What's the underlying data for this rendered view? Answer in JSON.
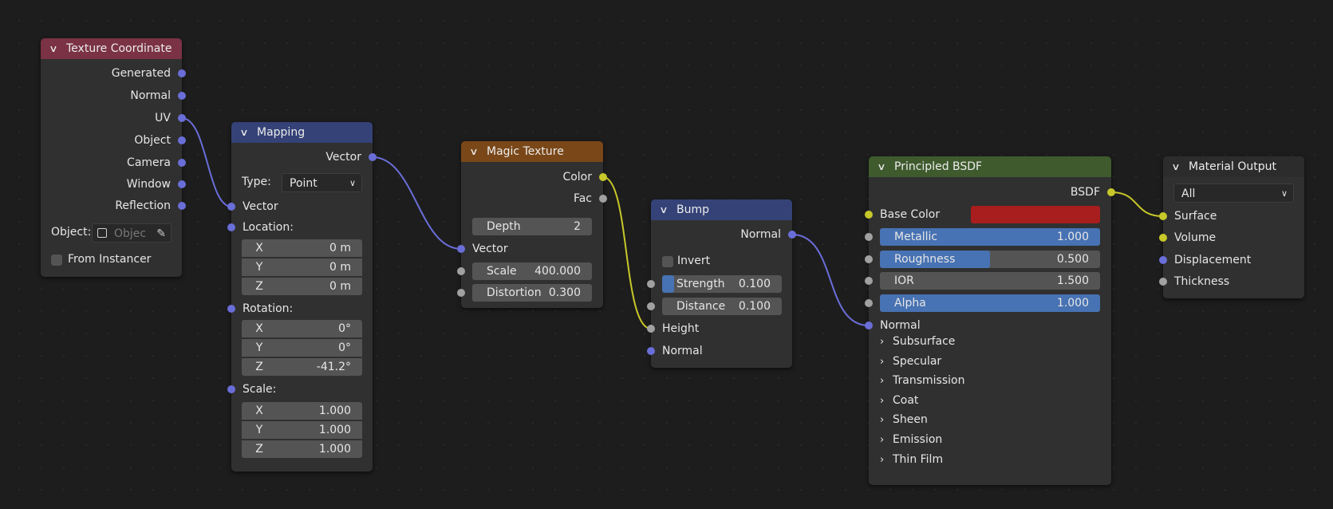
{
  "nodes": {
    "texture_coordinate": {
      "title": "Texture Coordinate",
      "header_color": "#7b3245",
      "outputs": [
        "Generated",
        "Normal",
        "UV",
        "Object",
        "Camera",
        "Window",
        "Reflection"
      ],
      "object_label": "Object:",
      "object_placeholder": "Objec",
      "from_instancer_label": "From Instancer",
      "from_instancer_checked": false
    },
    "mapping": {
      "title": "Mapping",
      "header_color": "#344277",
      "output": "Vector",
      "type_label": "Type:",
      "type_value": "Point",
      "vector_input": "Vector",
      "location_label": "Location:",
      "location": [
        {
          "axis": "X",
          "value": "0 m"
        },
        {
          "axis": "Y",
          "value": "0 m"
        },
        {
          "axis": "Z",
          "value": "0 m"
        }
      ],
      "rotation_label": "Rotation:",
      "rotation": [
        {
          "axis": "X",
          "value": "0°"
        },
        {
          "axis": "Y",
          "value": "0°"
        },
        {
          "axis": "Z",
          "value": "-41.2°"
        }
      ],
      "scale_label": "Scale:",
      "scale": [
        {
          "axis": "X",
          "value": "1.000"
        },
        {
          "axis": "Y",
          "value": "1.000"
        },
        {
          "axis": "Z",
          "value": "1.000"
        }
      ]
    },
    "magic_texture": {
      "title": "Magic Texture",
      "header_color": "#7a4718",
      "outputs": [
        "Color",
        "Fac"
      ],
      "depth_label": "Depth",
      "depth_value": "2",
      "vector_input": "Vector",
      "scale_label": "Scale",
      "scale_value": "400.000",
      "distortion_label": "Distortion",
      "distortion_value": "0.300"
    },
    "bump": {
      "title": "Bump",
      "header_color": "#344277",
      "output": "Normal",
      "invert_label": "Invert",
      "invert_checked": false,
      "strength_label": "Strength",
      "strength_value": "0.100",
      "strength_fraction": 0.1,
      "distance_label": "Distance",
      "distance_value": "0.100",
      "height_input": "Height",
      "normal_input": "Normal"
    },
    "principled_bsdf": {
      "title": "Principled BSDF",
      "header_color": "#3f5b2e",
      "output": "BSDF",
      "base_color_label": "Base Color",
      "base_color": "#a81d1d",
      "sliders": [
        {
          "label": "Metallic",
          "value": "1.000",
          "fraction": 1.0
        },
        {
          "label": "Roughness",
          "value": "0.500",
          "fraction": 0.5
        },
        {
          "label": "IOR",
          "value": "1.500",
          "fraction": 0.0
        },
        {
          "label": "Alpha",
          "value": "1.000",
          "fraction": 1.0
        }
      ],
      "normal_input": "Normal",
      "panels": [
        "Subsurface",
        "Specular",
        "Transmission",
        "Coat",
        "Sheen",
        "Emission",
        "Thin Film"
      ]
    },
    "material_output": {
      "title": "Material Output",
      "header_color": "#2c2c2c",
      "target": "All",
      "inputs": [
        "Surface",
        "Volume",
        "Displacement",
        "Thickness"
      ]
    }
  },
  "colors": {
    "socket_vector": "#6a6ed8",
    "socket_float": "#a1a1a1",
    "socket_color": "#c7c829",
    "slider_fill": "#4772b3"
  }
}
